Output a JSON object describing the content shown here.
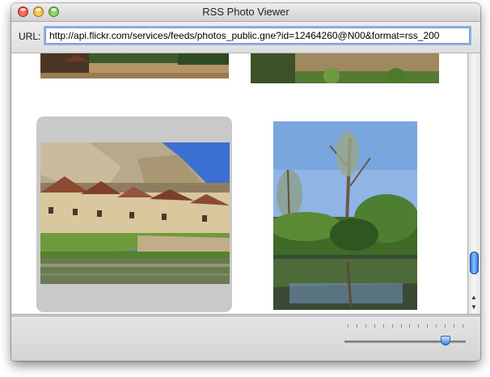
{
  "window": {
    "title": "RSS Photo Viewer",
    "buttons": [
      "close",
      "minimize",
      "zoom"
    ]
  },
  "url_bar": {
    "label": "URL:",
    "value": "http://api.flickr.com/services/feeds/photos_public.gne?id=12464260@N00&format=rss_200"
  },
  "gallery": {
    "photos": [
      {
        "name": "village-wall-photo",
        "selected": false,
        "partially_visible": true
      },
      {
        "name": "stone-wall-greenery-photo",
        "selected": false,
        "partially_visible": true
      },
      {
        "name": "cliff-village-river-photo",
        "selected": true,
        "partially_visible": false
      },
      {
        "name": "tree-river-reflection-photo",
        "selected": false,
        "partially_visible": false
      }
    ]
  },
  "scrollbar": {
    "position_fraction": 0.92
  },
  "zoom_slider": {
    "value_fraction": 0.83,
    "tick_count": 14
  },
  "colors": {
    "accent": "#3a7be0",
    "selection_frame": "#c9c9c9",
    "window_bg": "#e8e8e8"
  }
}
